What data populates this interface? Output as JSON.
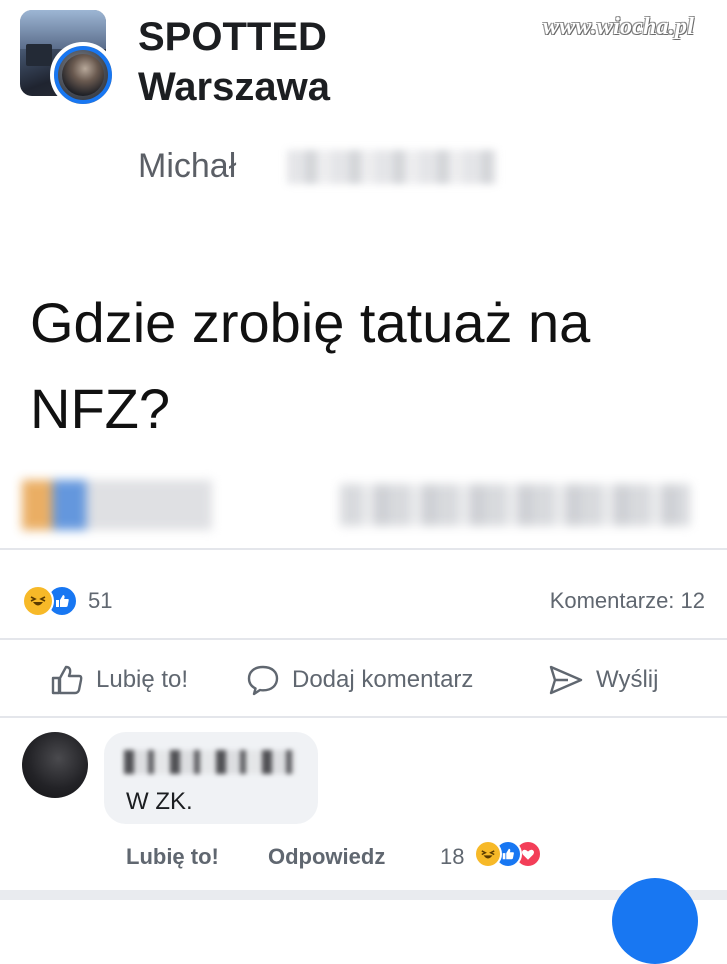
{
  "watermark": "www.wiocha.pl",
  "post": {
    "group_name": "SPOTTED\nWarszawa",
    "author": "Michał",
    "text": "Gdzie zrobię tatuaż na NFZ?"
  },
  "reactions": {
    "count": "51",
    "comments_label": "Komentarze: 12",
    "types": [
      "haha-icon",
      "like-icon"
    ]
  },
  "actions": {
    "like": "Lubię to!",
    "comment": "Dodaj komentarz",
    "send": "Wyślij"
  },
  "comment": {
    "text": "W ZK.",
    "like_label": "Lubię to!",
    "reply_label": "Odpowiedz",
    "reaction_count": "18",
    "reaction_types": [
      "haha-icon",
      "like-icon",
      "love-icon"
    ]
  },
  "colors": {
    "accent": "#1877f2",
    "haha": "#f7b928",
    "love": "#f33e58",
    "muted_text": "#606770"
  }
}
